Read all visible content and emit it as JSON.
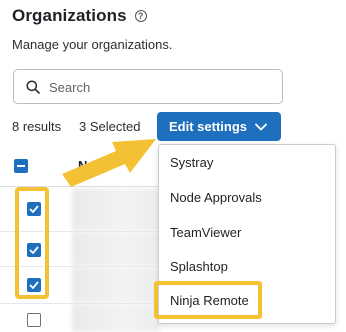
{
  "header": {
    "title": "Organizations",
    "help_icon": "?",
    "subtitle": "Manage your organizations."
  },
  "search": {
    "placeholder": "Search",
    "icon": "search-icon"
  },
  "toolbar": {
    "results": "8 results",
    "selected": "3 Selected",
    "edit_label": "Edit settings"
  },
  "table": {
    "header_name": "N"
  },
  "dropdown": {
    "items": [
      "Systray",
      "Node Approvals",
      "TeamViewer",
      "Splashtop",
      "Ninja Remote"
    ],
    "highlighted_item": "Ninja Remote"
  },
  "rows": [
    {
      "checked": true
    },
    {
      "checked": true
    },
    {
      "checked": true
    },
    {
      "checked": false
    }
  ],
  "colors": {
    "accent": "#1f6fbf",
    "highlight": "#f4c034"
  }
}
